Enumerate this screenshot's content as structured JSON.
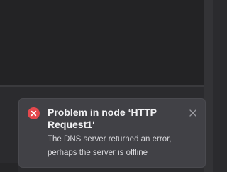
{
  "colors": {
    "canvas": "#232325",
    "toast_bg": "#414146",
    "error_red": "#e5484d",
    "title_text": "#f2f2f4",
    "body_text": "#d8d8dc"
  },
  "toast": {
    "type": "error",
    "icon": "error-circle-x-icon",
    "title": "Problem in node ‘HTTP Request1‘",
    "message": "The DNS server returned an error, perhaps the server is offline",
    "close_icon": "close-icon"
  }
}
